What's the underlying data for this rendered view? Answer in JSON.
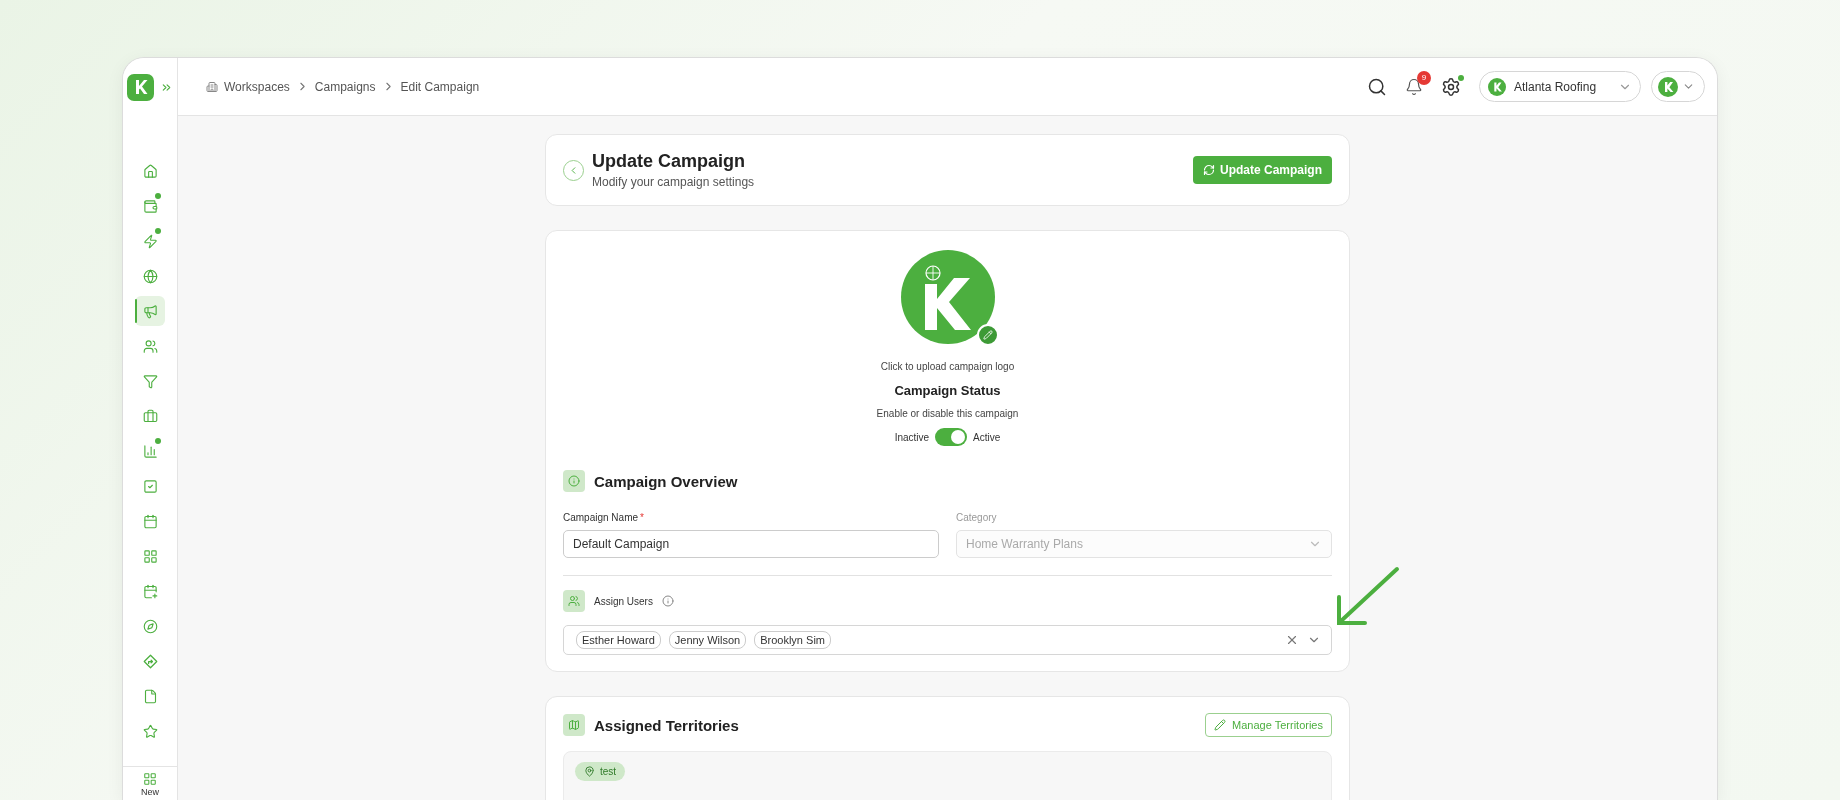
{
  "sidebar": {
    "items": [
      {
        "kind": "home",
        "selected": false,
        "dot": false
      },
      {
        "kind": "wallet",
        "selected": false,
        "dot": true
      },
      {
        "kind": "zap",
        "selected": false,
        "dot": true
      },
      {
        "kind": "globe",
        "selected": false,
        "dot": false
      },
      {
        "kind": "megaphone",
        "selected": true,
        "dot": false
      },
      {
        "kind": "users",
        "selected": false,
        "dot": false
      },
      {
        "kind": "filter",
        "selected": false,
        "dot": false
      },
      {
        "kind": "briefcase",
        "selected": false,
        "dot": false
      },
      {
        "kind": "chart",
        "selected": false,
        "dot": true
      },
      {
        "kind": "check",
        "selected": false,
        "dot": false
      },
      {
        "kind": "calendar",
        "selected": false,
        "dot": false
      },
      {
        "kind": "grid",
        "selected": false,
        "dot": false
      },
      {
        "kind": "calendar-plus",
        "selected": false,
        "dot": false
      },
      {
        "kind": "compass",
        "selected": false,
        "dot": false
      },
      {
        "kind": "route",
        "selected": false,
        "dot": false
      },
      {
        "kind": "file",
        "selected": false,
        "dot": false
      },
      {
        "kind": "star",
        "selected": false,
        "dot": false
      }
    ],
    "footer": {
      "label": "New"
    }
  },
  "breadcrumb": [
    {
      "label": "Workspaces"
    },
    {
      "label": "Campaigns"
    },
    {
      "label": "Edit Campaign"
    }
  ],
  "topbar": {
    "notifications": "9",
    "settings_dot": true,
    "workspace": "Atlanta Roofing"
  },
  "header": {
    "title": "Update Campaign",
    "subtitle": "Modify your campaign settings",
    "button": "Update Campaign"
  },
  "logo_upload": {
    "hint": "Click to upload campaign logo"
  },
  "status": {
    "title": "Campaign Status",
    "description": "Enable or disable this campaign",
    "off_label": "Inactive",
    "on_label": "Active",
    "on": true
  },
  "overview": {
    "title": "Campaign Overview",
    "fields": [
      {
        "kind": "text",
        "label": "Campaign Name",
        "required_mark": "*",
        "value": "Default Campaign",
        "disabled": false
      },
      {
        "kind": "select",
        "label": "Category",
        "value": "Home Warranty Plans",
        "disabled": true
      }
    ]
  },
  "assign_users": {
    "label": "Assign Users",
    "selected": [
      "Esther Howard",
      "Jenny Wilson",
      "Brooklyn Sim"
    ]
  },
  "territories": {
    "title": "Assigned Territories",
    "button": "Manage Territories",
    "items": [
      {
        "label": "test"
      }
    ]
  }
}
